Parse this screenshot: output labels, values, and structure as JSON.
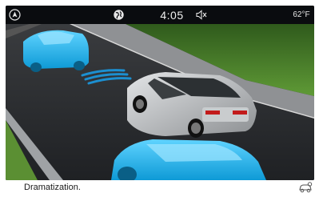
{
  "status_bar": {
    "nav_icon": "navigation-arrow-icon",
    "globe_icon": "globe-icon",
    "time": "4:05",
    "mute_icon": "speaker-muted-icon",
    "temperature": "62°F"
  },
  "scene": {
    "description_items": [
      "blue-car-left",
      "sensor-waves",
      "silver-suv",
      "blue-car-front"
    ],
    "colors": {
      "blue_car": "#18b6ec",
      "silver_car": "#b8bbbe",
      "road": "#2b2d30",
      "grass": "#4f8a2c",
      "sensor": "#1c8fd0"
    }
  },
  "footer": {
    "caption": "Dramatization.",
    "settings_icon": "car-settings-icon"
  }
}
